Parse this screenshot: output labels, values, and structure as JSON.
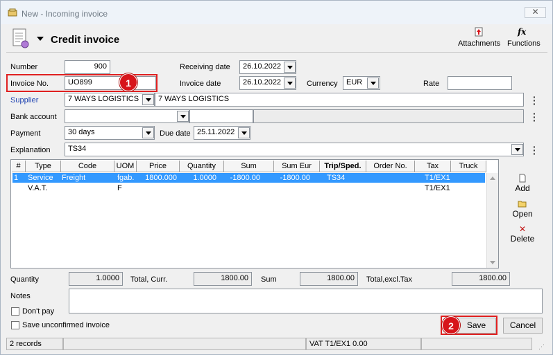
{
  "window": {
    "title": "New - Incoming invoice",
    "close_glyph": "✕"
  },
  "header": {
    "title": "Credit invoice",
    "attachments_label": "Attachments",
    "functions_label": "Functions",
    "functions_glyph": "fx"
  },
  "form": {
    "number_label": "Number",
    "number_value": "900",
    "receiving_date_label": "Receiving date",
    "receiving_date_value": "26.10.2022",
    "invoice_no_label": "Invoice No.",
    "invoice_no_value": "UO899",
    "invoice_date_label": "Invoice date",
    "invoice_date_value": "26.10.2022",
    "currency_label": "Currency",
    "currency_value": "EUR",
    "rate_label": "Rate",
    "rate_value": "",
    "supplier_label": "Supplier",
    "supplier_code": "7 WAYS LOGISTICS",
    "supplier_name": "7 WAYS LOGISTICS",
    "bank_account_label": "Bank account",
    "bank_account_value": "",
    "bank_account_extra": "",
    "payment_label": "Payment",
    "payment_value": "30 days",
    "due_date_label": "Due date",
    "due_date_value": "25.11.2022",
    "explanation_label": "Explanation",
    "explanation_value": "TS34"
  },
  "table": {
    "columns": [
      "#",
      "Type",
      "Code",
      "UOM",
      "Price",
      "Quantity",
      "Sum",
      "Sum Eur",
      "Trip/Sped.",
      "Order No.",
      "Tax",
      "Truck"
    ],
    "rows": [
      [
        "1",
        "Service",
        "Freight",
        "fgab.",
        "1800.000",
        "1.0000",
        "-1800.00",
        "-1800.00",
        "TS34",
        "",
        "T1/EX1",
        ""
      ],
      [
        "",
        "V.A.T.",
        "",
        "F",
        "",
        "",
        "",
        "",
        "",
        "",
        "T1/EX1",
        ""
      ]
    ]
  },
  "side_actions": {
    "add": "Add",
    "open": "Open",
    "delete": "Delete"
  },
  "totals": {
    "quantity_label": "Quantity",
    "quantity_value": "1.0000",
    "total_curr_label": "Total, Curr.",
    "total_curr_value": "1800.00",
    "sum_label": "Sum",
    "sum_value": "1800.00",
    "total_excl_tax_label": "Total,excl.Tax",
    "total_excl_tax_value": "1800.00"
  },
  "notes": {
    "label": "Notes",
    "value": "",
    "dont_pay_label": "Don't pay",
    "save_unconfirmed_label": "Save unconfirmed invoice"
  },
  "buttons": {
    "save": "Save",
    "cancel": "Cancel"
  },
  "status": {
    "records": "2 records",
    "vat": "VAT T1/EX1  0.00"
  },
  "callouts": {
    "one": "1",
    "two": "2"
  },
  "colors": {
    "accent_red": "#d7141a",
    "selection_blue": "#3399ff",
    "supplier_link": "#1a3fb0"
  }
}
